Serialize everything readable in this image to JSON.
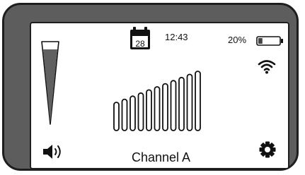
{
  "calendar": {
    "icon": "calendar-icon",
    "day": "28"
  },
  "clock": {
    "time": "12:43"
  },
  "battery": {
    "percent_label": "20%",
    "level": 0.2,
    "icon": "battery-icon"
  },
  "wifi": {
    "icon": "wifi-icon"
  },
  "volume": {
    "icon": "speaker-icon",
    "level_icon": "volume-level-wedge"
  },
  "signal": {
    "icon": "signal-strength-bars",
    "bars": 11
  },
  "channel": {
    "label": "Channel A"
  },
  "settings": {
    "icon": "gear-icon"
  },
  "colors": {
    "bezel": "#5d5d5d",
    "screen": "#ffffff",
    "ink": "#111111",
    "volume_fill": "#606060"
  }
}
